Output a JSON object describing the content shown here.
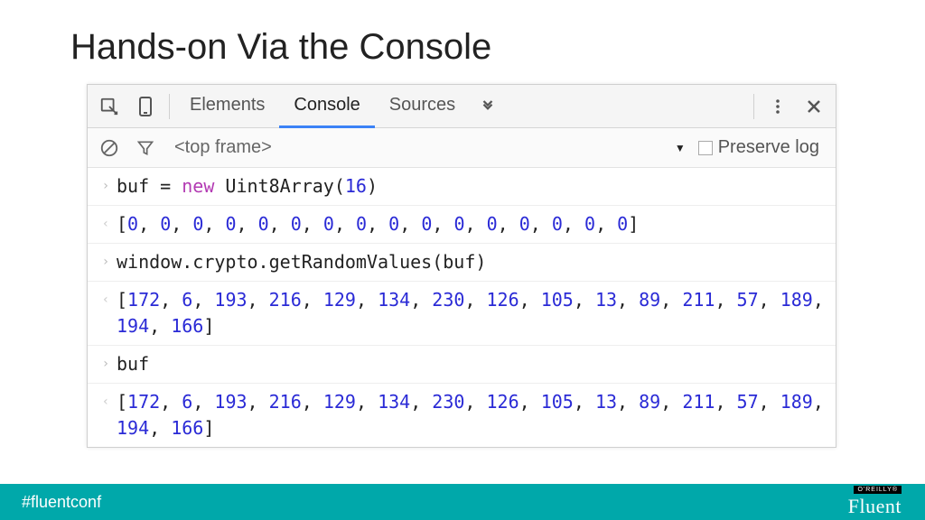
{
  "title": "Hands-on Via the Console",
  "tabs": {
    "elements": "Elements",
    "console": "Console",
    "sources": "Sources"
  },
  "frame_context": "<top frame>",
  "preserve_label": "Preserve log",
  "lines": [
    {
      "type": "in",
      "segments": [
        {
          "t": "buf = "
        },
        {
          "t": "new ",
          "c": "kw"
        },
        {
          "t": "Uint8Array("
        },
        {
          "t": "16",
          "c": "num"
        },
        {
          "t": ")"
        }
      ]
    },
    {
      "type": "out",
      "array": [
        0,
        0,
        0,
        0,
        0,
        0,
        0,
        0,
        0,
        0,
        0,
        0,
        0,
        0,
        0,
        0
      ]
    },
    {
      "type": "in",
      "segments": [
        {
          "t": "window.crypto.getRandomValues(buf)"
        }
      ]
    },
    {
      "type": "out",
      "array": [
        172,
        6,
        193,
        216,
        129,
        134,
        230,
        126,
        105,
        13,
        89,
        211,
        57,
        189,
        194,
        166
      ]
    },
    {
      "type": "in",
      "segments": [
        {
          "t": "buf"
        }
      ]
    },
    {
      "type": "out",
      "array": [
        172,
        6,
        193,
        216,
        129,
        134,
        230,
        126,
        105,
        13,
        89,
        211,
        57,
        189,
        194,
        166
      ]
    }
  ],
  "footer": {
    "hashtag": "#fluentconf",
    "oreilly": "O'REILLY®",
    "brand": "Fluent"
  }
}
